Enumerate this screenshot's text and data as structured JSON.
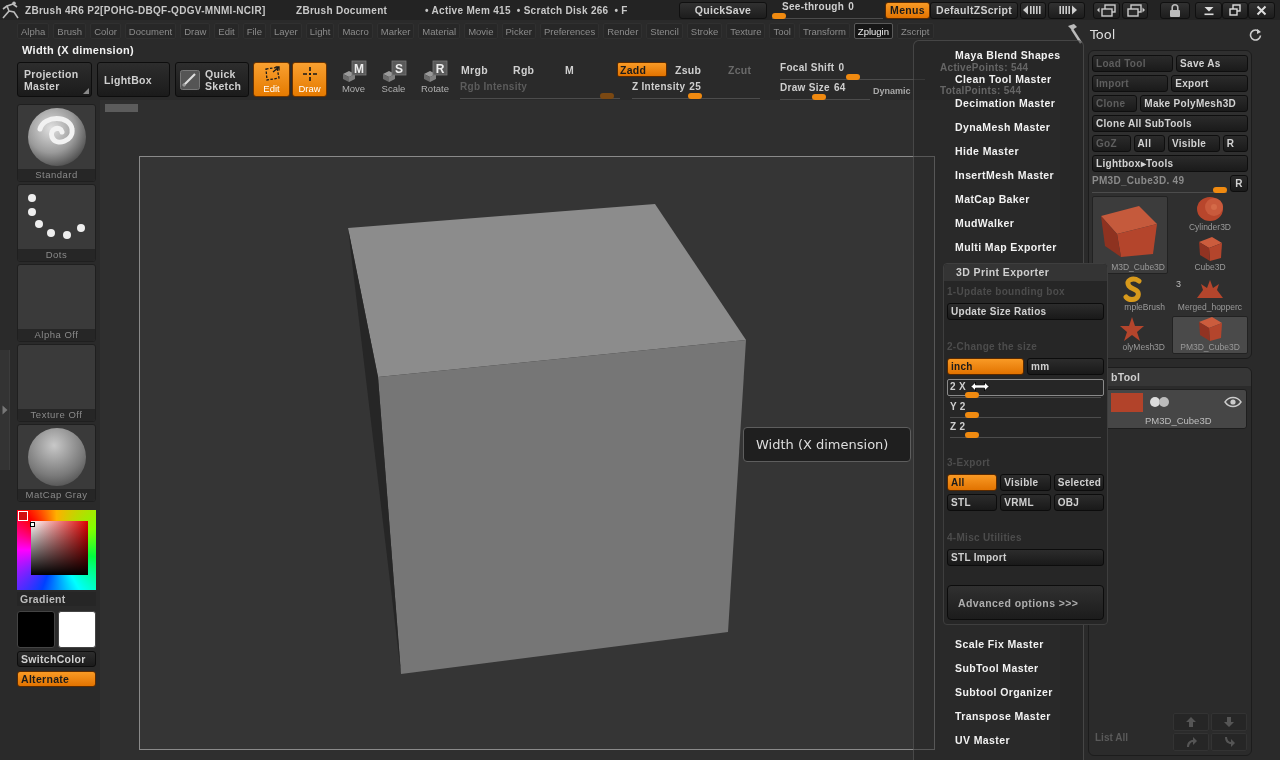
{
  "title_bar": {
    "app_title": "ZBrush 4R6 P2[POHG-DBQF-QDGV-MNMI-NCIR]",
    "document": "ZBrush Document",
    "stats": [
      "• Active Mem 415",
      "• Scratch Disk 266",
      "• F"
    ],
    "quick_save": "QuickSave",
    "see_through": {
      "label": "See-through",
      "reading": "0",
      "level": 0
    },
    "menus": {
      "label": "Menus",
      "on": true
    },
    "script": "DefaultZScript"
  },
  "menu_bar": [
    {
      "label": "Alpha",
      "selected": false
    },
    {
      "label": "Brush",
      "selected": false
    },
    {
      "label": "Color",
      "selected": false
    },
    {
      "label": "Document",
      "selected": false
    },
    {
      "label": "Draw",
      "selected": false
    },
    {
      "label": "Edit",
      "selected": false
    },
    {
      "label": "File",
      "selected": false
    },
    {
      "label": "Layer",
      "selected": false
    },
    {
      "label": "Light",
      "selected": false
    },
    {
      "label": "Macro",
      "selected": false
    },
    {
      "label": "Marker",
      "selected": false
    },
    {
      "label": "Material",
      "selected": false
    },
    {
      "label": "Movie",
      "selected": false
    },
    {
      "label": "Picker",
      "selected": false
    },
    {
      "label": "Preferences",
      "selected": false
    },
    {
      "label": "Render",
      "selected": false
    },
    {
      "label": "Stencil",
      "selected": false
    },
    {
      "label": "Stroke",
      "selected": false
    },
    {
      "label": "Texture",
      "selected": false
    },
    {
      "label": "Tool",
      "selected": false
    },
    {
      "label": "Transform",
      "selected": false
    },
    {
      "label": "Zplugin",
      "selected": true
    },
    {
      "label": "Zscript",
      "selected": false
    }
  ],
  "info_line": "Width (X dimension)",
  "toolbar": {
    "projection_master": "Projection Master",
    "lightbox": "LightBox",
    "quick_sketch": "Quick Sketch",
    "modes": [
      {
        "kind": "edit",
        "label": "Edit",
        "on": true
      },
      {
        "kind": "draw",
        "label": "Draw",
        "on": true
      },
      {
        "kind": "move",
        "label": "Move",
        "key": "M",
        "on": false
      },
      {
        "kind": "scale",
        "label": "Scale",
        "key": "S",
        "on": false
      },
      {
        "kind": "rotate",
        "label": "Rotate",
        "key": "R",
        "on": false
      }
    ],
    "channels": [
      {
        "label": "Mrgb",
        "on": false
      },
      {
        "label": "Rgb",
        "on": false
      },
      {
        "label": "M",
        "on": false
      }
    ],
    "depth_modes": [
      {
        "label": "Zadd",
        "on": true,
        "disabled": false
      },
      {
        "label": "Zsub",
        "on": false,
        "disabled": false
      },
      {
        "label": "Zcut",
        "on": false,
        "disabled": true
      }
    ],
    "intensity_sliders": [
      {
        "label": "Rgb Intensity",
        "disabled": true,
        "level": 0.96
      },
      {
        "label": "Z Intensity",
        "reading": "25",
        "disabled": false,
        "level": 0.49
      }
    ],
    "draw_sliders": [
      {
        "label": "Focal Shift",
        "reading": "0",
        "level": 0.5
      },
      {
        "label": "Draw Size",
        "reading": "64",
        "level": 0.42
      }
    ],
    "dynamic": "Dynamic",
    "points": [
      "ActivePoints: 544",
      "TotalPoints: 544"
    ]
  },
  "left_shelf": {
    "items": [
      {
        "kind": "brush",
        "label": "Standard"
      },
      {
        "kind": "stroke",
        "label": "Dots"
      },
      {
        "kind": "alpha",
        "label": "Alpha Off"
      },
      {
        "kind": "texture",
        "label": "Texture Off"
      },
      {
        "kind": "material",
        "label": "MatCap Gray"
      }
    ],
    "gradient": "Gradient",
    "swatches": [
      {
        "color": "#000000"
      },
      {
        "color": "#ffffff"
      }
    ],
    "switch_color": "SwitchColor",
    "alternate": {
      "label": "Alternate",
      "on": true
    }
  },
  "tooltip": "Width (X dimension)",
  "zplugin_menu": {
    "items": [
      {
        "label": "Maya Blend Shapes",
        "expanded": false
      },
      {
        "label": "Clean Tool Master",
        "expanded": false
      },
      {
        "label": "Decimation Master",
        "expanded": false
      },
      {
        "label": "DynaMesh Master",
        "expanded": false
      },
      {
        "label": "Hide Master",
        "expanded": false
      },
      {
        "label": "InsertMesh Master",
        "expanded": false
      },
      {
        "label": "MatCap Baker",
        "expanded": false
      },
      {
        "label": "MudWalker",
        "expanded": false
      },
      {
        "label": "Multi Map Exporter",
        "expanded": false
      },
      {
        "label": "3D Print Exporter",
        "expanded": true,
        "sections": [
          {
            "heading": "1-Update bounding box",
            "controls": [
              {
                "kind": "button",
                "label": "Update Size Ratios"
              }
            ]
          },
          {
            "heading": "2-Change the size",
            "controls": [
              {
                "kind": "choice",
                "options": [
                  {
                    "label": "inch",
                    "selected": true
                  },
                  {
                    "label": "mm",
                    "selected": false
                  }
                ]
              },
              {
                "kind": "slider",
                "label": "2 X",
                "level": 0.11,
                "focused": true
              },
              {
                "kind": "slider",
                "label": "Y 2",
                "level": 0.11,
                "focused": false
              },
              {
                "kind": "slider",
                "label": "Z 2",
                "level": 0.11,
                "focused": false
              }
            ]
          },
          {
            "heading": "3-Export",
            "controls": [
              {
                "kind": "choice",
                "options": [
                  {
                    "label": "All",
                    "selected": true
                  },
                  {
                    "label": "Visible",
                    "selected": false
                  },
                  {
                    "label": "Selected",
                    "selected": false
                  }
                ]
              },
              {
                "kind": "buttons",
                "labels": [
                  "STL",
                  "VRML",
                  "OBJ"
                ]
              }
            ]
          },
          {
            "heading": "4-Misc Utilities",
            "controls": [
              {
                "kind": "button",
                "label": "STL Import"
              }
            ]
          }
        ],
        "advanced": "Advanced options >>>"
      },
      {
        "label": "Scale Fix Master",
        "expanded": false
      },
      {
        "label": "SubTool Master",
        "expanded": false
      },
      {
        "label": "Subtool Organizer",
        "expanded": false
      },
      {
        "label": "Transpose Master",
        "expanded": false
      },
      {
        "label": "UV Master",
        "expanded": false
      }
    ]
  },
  "tool_panel": {
    "title": "Tool",
    "button_rows": [
      [
        {
          "label": "Load Tool",
          "disabled": true
        },
        {
          "label": "Save As",
          "disabled": false
        }
      ],
      [
        {
          "label": "Import",
          "disabled": true
        },
        {
          "label": "Export",
          "disabled": false
        }
      ],
      [
        {
          "label": "Clone",
          "disabled": true
        },
        {
          "label": "Make PolyMesh3D",
          "disabled": false
        }
      ],
      [
        {
          "label": "Clone All SubTools",
          "disabled": false
        }
      ],
      [
        {
          "label": "GoZ",
          "disabled": true
        },
        {
          "label": "All",
          "disabled": false
        },
        {
          "label": "Visible",
          "disabled": false
        },
        {
          "label": "R",
          "disabled": false
        }
      ],
      [
        {
          "label": "Lightbox▸Tools",
          "disabled": false
        }
      ]
    ],
    "tool_slider": {
      "label": "PM3D_Cube3D. 49",
      "level": 1,
      "reset": "R"
    },
    "tools": [
      {
        "kind": "current",
        "label": "M3D_Cube3D",
        "selected": false
      },
      {
        "kind": "cylinder",
        "label": "Cylinder3D",
        "selected": false
      },
      {
        "kind": "cube",
        "label": "Cube3D",
        "selected": false
      },
      {
        "kind": "brush",
        "label": "mpleBrush",
        "selected": false
      },
      {
        "kind": "merged",
        "label": "Merged_hopperc",
        "count": "3",
        "selected": false
      },
      {
        "kind": "polymesh",
        "label": "olyMesh3D",
        "selected": false
      },
      {
        "kind": "cube",
        "label": "PM3D_Cube3D",
        "selected": true
      }
    ]
  },
  "subtool": {
    "title": "bTool",
    "items": [
      {
        "label": "PM3D_Cube3D",
        "selected": true
      }
    ],
    "list_all": "List All"
  }
}
